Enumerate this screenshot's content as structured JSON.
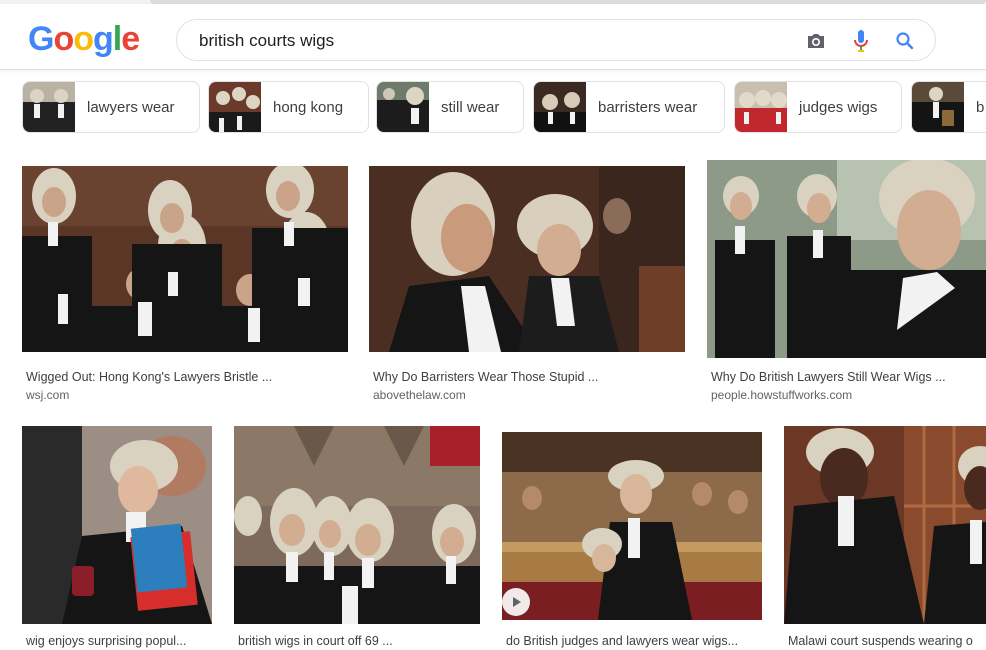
{
  "query": "british courts wigs",
  "logo": {
    "letters": [
      "G",
      "o",
      "o",
      "g",
      "l",
      "e"
    ],
    "colors": [
      "#4285F4",
      "#EA4335",
      "#FBBC05",
      "#4285F4",
      "#34A853",
      "#EA4335"
    ]
  },
  "chips": [
    {
      "label": "lawyers wear"
    },
    {
      "label": "hong kong"
    },
    {
      "label": "still wear"
    },
    {
      "label": "barristers wear"
    },
    {
      "label": "judges wigs"
    },
    {
      "label": "b"
    }
  ],
  "results": [
    {
      "title": "Wigged Out: Hong Kong's Lawyers Bristle ...",
      "source": "wsj.com"
    },
    {
      "title": "Why Do Barristers Wear Those Stupid ...",
      "source": "abovethelaw.com"
    },
    {
      "title": "Why Do British Lawyers Still Wear Wigs ...",
      "source": "people.howstuffworks.com"
    },
    {
      "title": "wig enjoys surprising popul...",
      "source": ""
    },
    {
      "title": "british wigs in court off 69 ...",
      "source": ""
    },
    {
      "title": "do British judges and lawyers wear wigs...",
      "source": ""
    },
    {
      "title": "Malawi court suspends wearing o",
      "source": ""
    }
  ],
  "icons": {
    "camera": "camera-icon",
    "mic": "microphone-icon",
    "search": "search-icon",
    "play": "play-icon"
  },
  "colors": {
    "wig": "#d9d2c1",
    "robe": "#151515",
    "bench": "#5a3626",
    "shirt": "#f2f2f2"
  }
}
